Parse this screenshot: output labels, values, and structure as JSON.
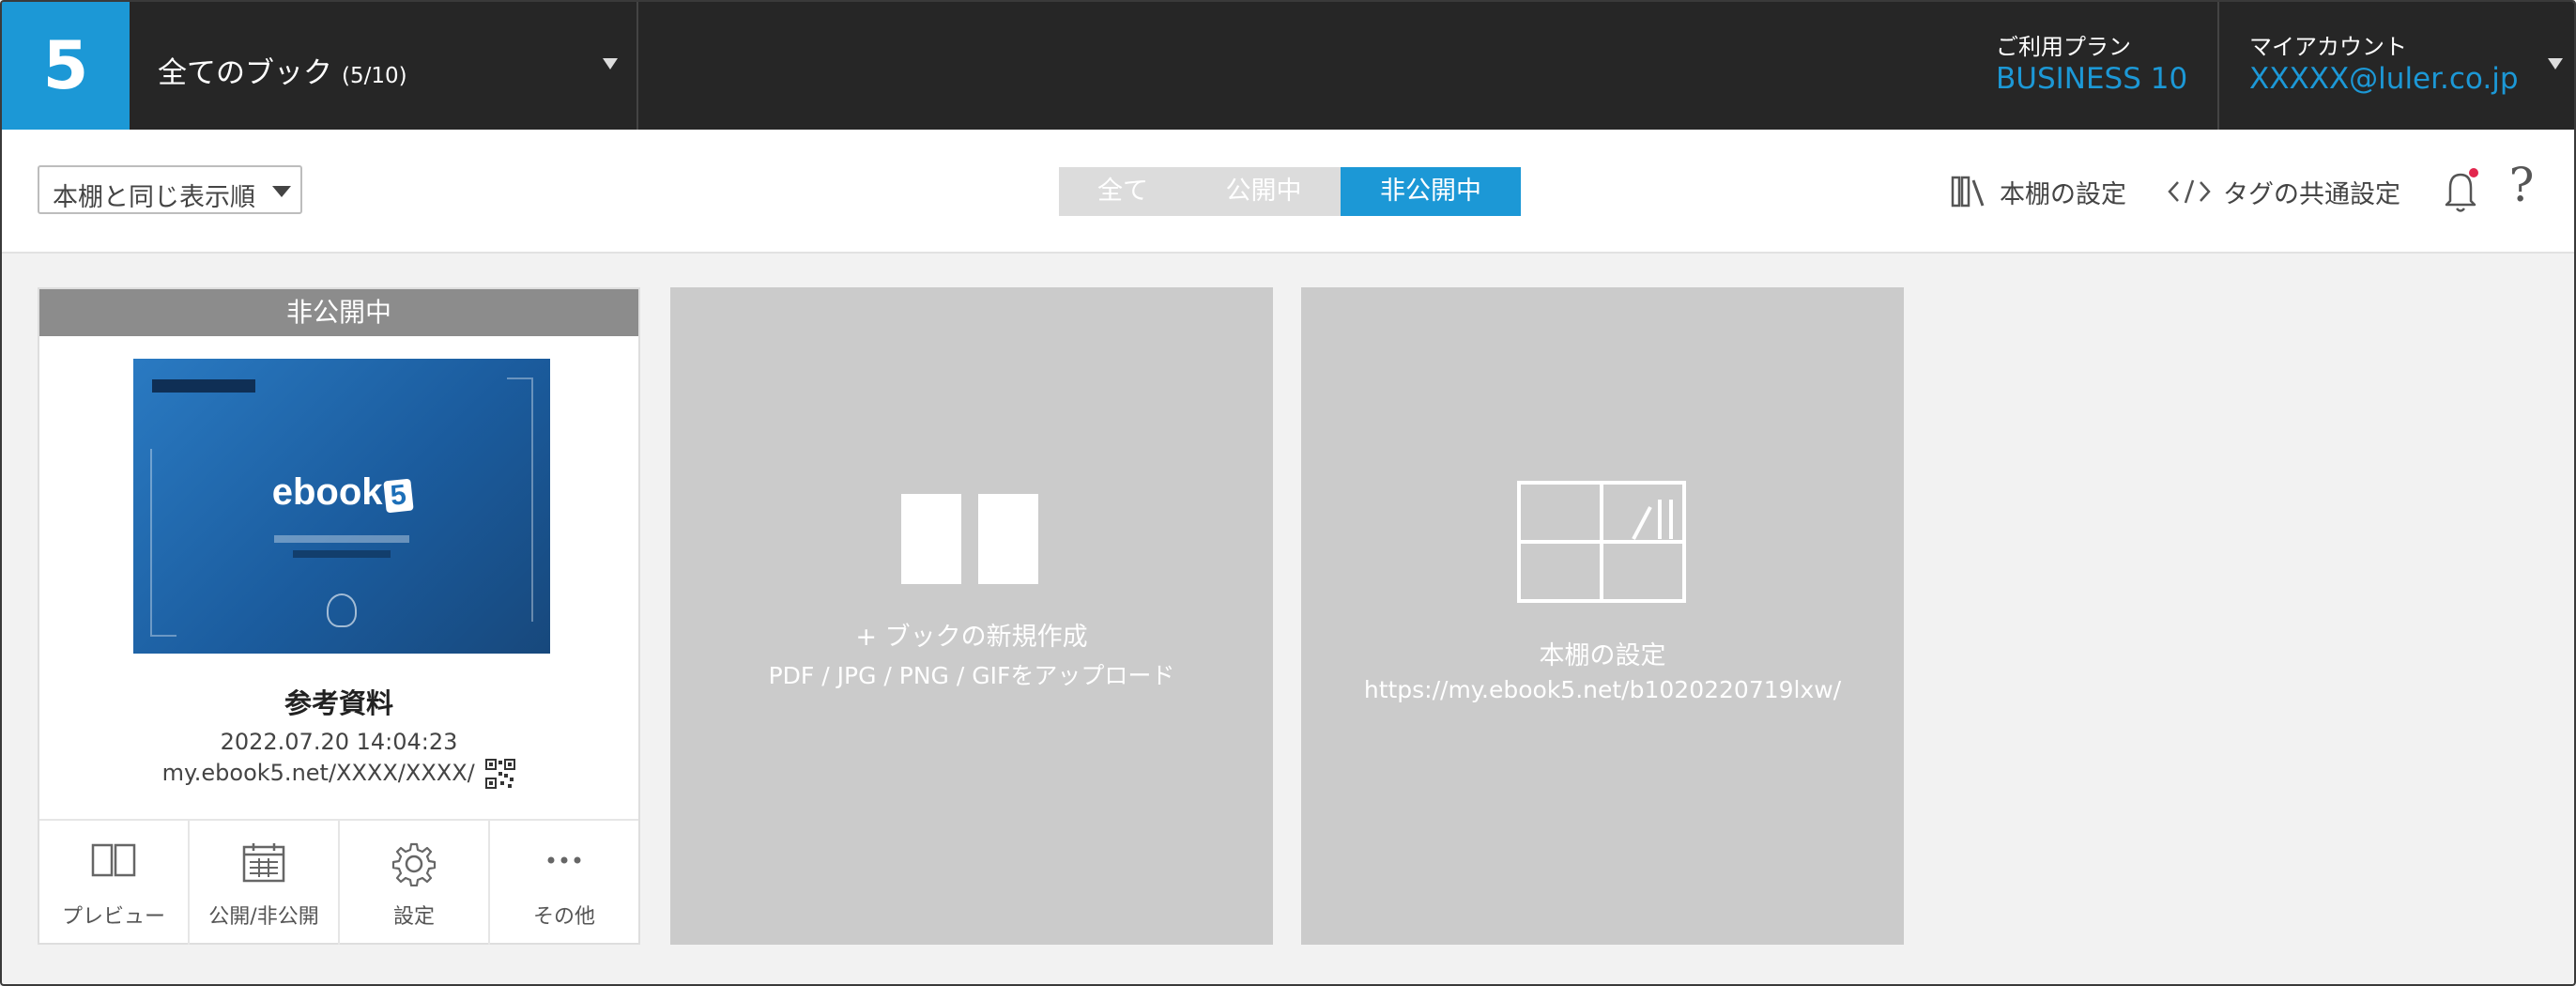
{
  "app": {
    "logo_text": "5",
    "book_selector": {
      "label": "全てのブック",
      "count": "(5/10)"
    },
    "plan": {
      "caption": "ご利用プラン",
      "value": "BUSINESS 10"
    },
    "account": {
      "caption": "マイアカウント",
      "value": "XXXXX@luler.co.jp"
    },
    "accent_color": "#1c98d6"
  },
  "toolbar": {
    "sort_select": {
      "value": "本棚と同じ表示順"
    },
    "filter_tabs": [
      {
        "label": "全て",
        "active": false
      },
      {
        "label": "公開中",
        "active": false
      },
      {
        "label": "非公開中",
        "active": true
      }
    ],
    "shelf_settings": {
      "label": "本棚の設定",
      "icon": "books-icon"
    },
    "tag_settings": {
      "label": "タグの共通設定",
      "icon": "code-tag-icon"
    },
    "notifications": {
      "icon": "bell-icon",
      "has_unread": true
    },
    "help": {
      "label": "?"
    }
  },
  "books": [
    {
      "status": "非公開中",
      "title": "参考資料",
      "date": "2022.07.20 14:04:23",
      "url": "my.ebook5.net/XXXX/XXXX/",
      "cover_brand": "ebook",
      "cover_brand_number": "5",
      "actions": [
        {
          "label": "プレビュー",
          "icon": "preview-icon"
        },
        {
          "label": "公開/非公開",
          "icon": "calendar-icon"
        },
        {
          "label": "設定",
          "icon": "gear-icon"
        },
        {
          "label": "その他",
          "icon": "more-icon"
        }
      ]
    }
  ],
  "new_book_card": {
    "title": "+ ブックの新規作成",
    "subtitle": "PDF / JPG / PNG / GIFをアップロード"
  },
  "shelf_card": {
    "title": "本棚の設定",
    "url": "https://my.ebook5.net/b1020220719lxw/"
  }
}
